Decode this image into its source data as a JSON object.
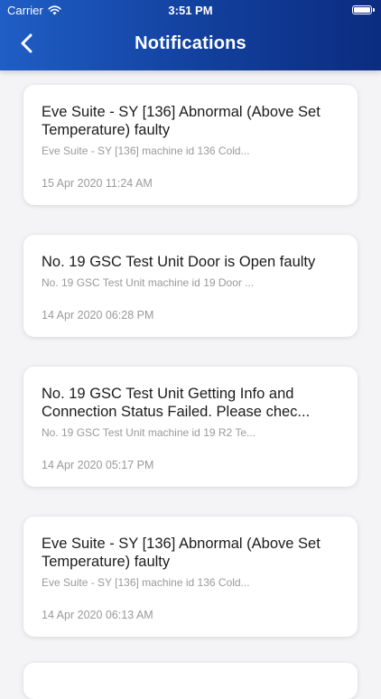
{
  "status_bar": {
    "carrier": "Carrier",
    "time": "3:51 PM"
  },
  "header": {
    "title": "Notifications"
  },
  "notifications": [
    {
      "title": "Eve Suite - SY [136] Abnormal (Above Set Temperature) faulty",
      "subtitle": "Eve Suite - SY [136] machine id 136 Cold...",
      "date": "15 Apr 2020 11:24 AM"
    },
    {
      "title": "No. 19 GSC Test Unit Door is Open faulty",
      "subtitle": "No. 19 GSC Test Unit machine id 19 Door ...",
      "date": "14 Apr 2020 06:28 PM"
    },
    {
      "title": "No. 19 GSC Test Unit Getting Info and Connection Status Failed. Please chec...",
      "subtitle": "No. 19 GSC Test Unit machine id 19 R2 Te...",
      "date": "14 Apr 2020 05:17 PM"
    },
    {
      "title": "Eve Suite - SY [136] Abnormal (Above Set Temperature) faulty",
      "subtitle": "Eve Suite - SY [136] machine id 136 Cold...",
      "date": "14 Apr 2020 06:13 AM"
    }
  ]
}
